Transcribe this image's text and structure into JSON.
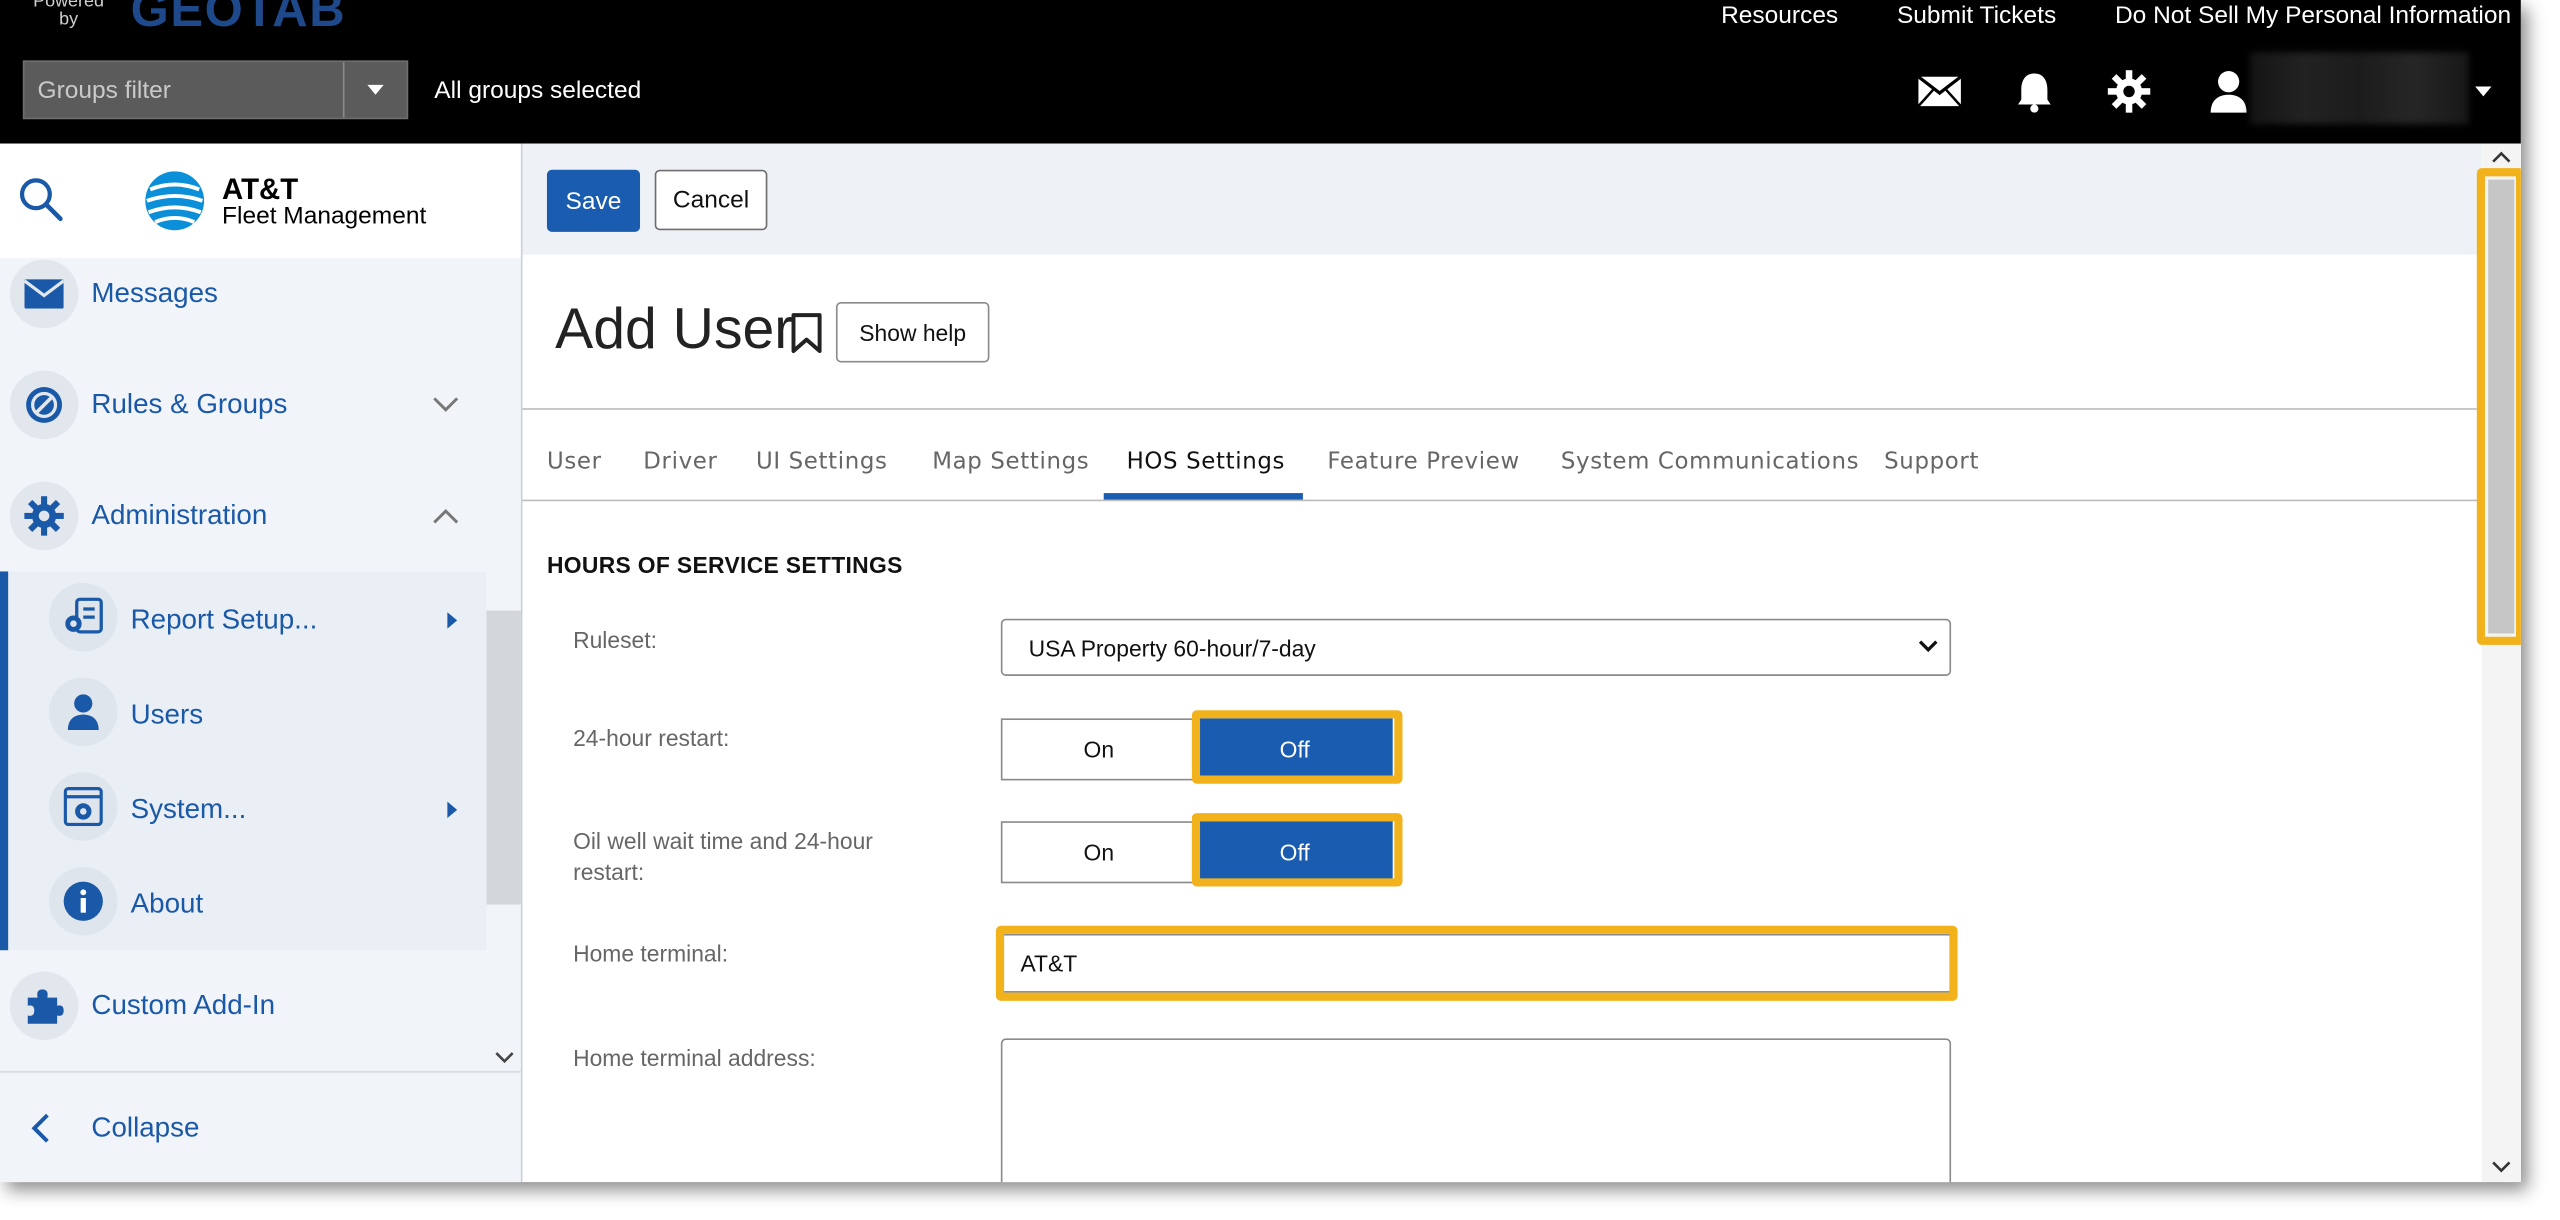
{
  "topbar": {
    "powered_by": "Powered by",
    "brand": "GEOTAB",
    "links": [
      "Resources",
      "Submit Tickets",
      "Do Not Sell My Personal Information"
    ],
    "groups_filter_placeholder": "Groups filter",
    "groups_status": "All groups selected",
    "icons": [
      "mail-icon",
      "bell-icon",
      "gear-icon",
      "user-icon"
    ]
  },
  "sidebar": {
    "logo_line1": "AT&T",
    "logo_line2": "Fleet Management",
    "items": [
      {
        "label": "Messages",
        "icon": "envelope-icon"
      },
      {
        "label": "Rules & Groups",
        "icon": "rules-icon"
      },
      {
        "label": "Administration",
        "icon": "gear-icon"
      }
    ],
    "sub_items": [
      {
        "label": "Report Setup...",
        "icon": "report-icon"
      },
      {
        "label": "Users",
        "icon": "user-icon"
      },
      {
        "label": "System...",
        "icon": "system-icon"
      },
      {
        "label": "About",
        "icon": "info-icon"
      }
    ],
    "custom_addin": "Custom Add-In",
    "collapse": "Collapse"
  },
  "toolbar": {
    "save_label": "Save",
    "cancel_label": "Cancel"
  },
  "page": {
    "title": "Add User",
    "show_help": "Show help"
  },
  "tabs": [
    "User",
    "Driver",
    "UI Settings",
    "Map Settings",
    "HOS Settings",
    "Feature Preview",
    "System Communications",
    "Support"
  ],
  "active_tab": "HOS Settings",
  "form": {
    "section_title": "HOURS OF SERVICE SETTINGS",
    "ruleset_label": "Ruleset:",
    "ruleset_value": "USA Property 60-hour/7-day",
    "restart_label": "24-hour restart:",
    "oilwell_label_1": "Oil well wait time and 24-hour",
    "oilwell_label_2": "restart:",
    "toggle_on": "On",
    "toggle_off": "Off",
    "restart_value": "Off",
    "oilwell_value": "Off",
    "home_terminal_label": "Home terminal:",
    "home_terminal_value": "AT&T",
    "home_terminal_address_label": "Home terminal address:",
    "home_terminal_address_value": ""
  },
  "colors": {
    "accent": "#1a5cb0",
    "highlight": "#f2b21b",
    "topbar": "#000000",
    "nav_text": "#1a58a8"
  }
}
